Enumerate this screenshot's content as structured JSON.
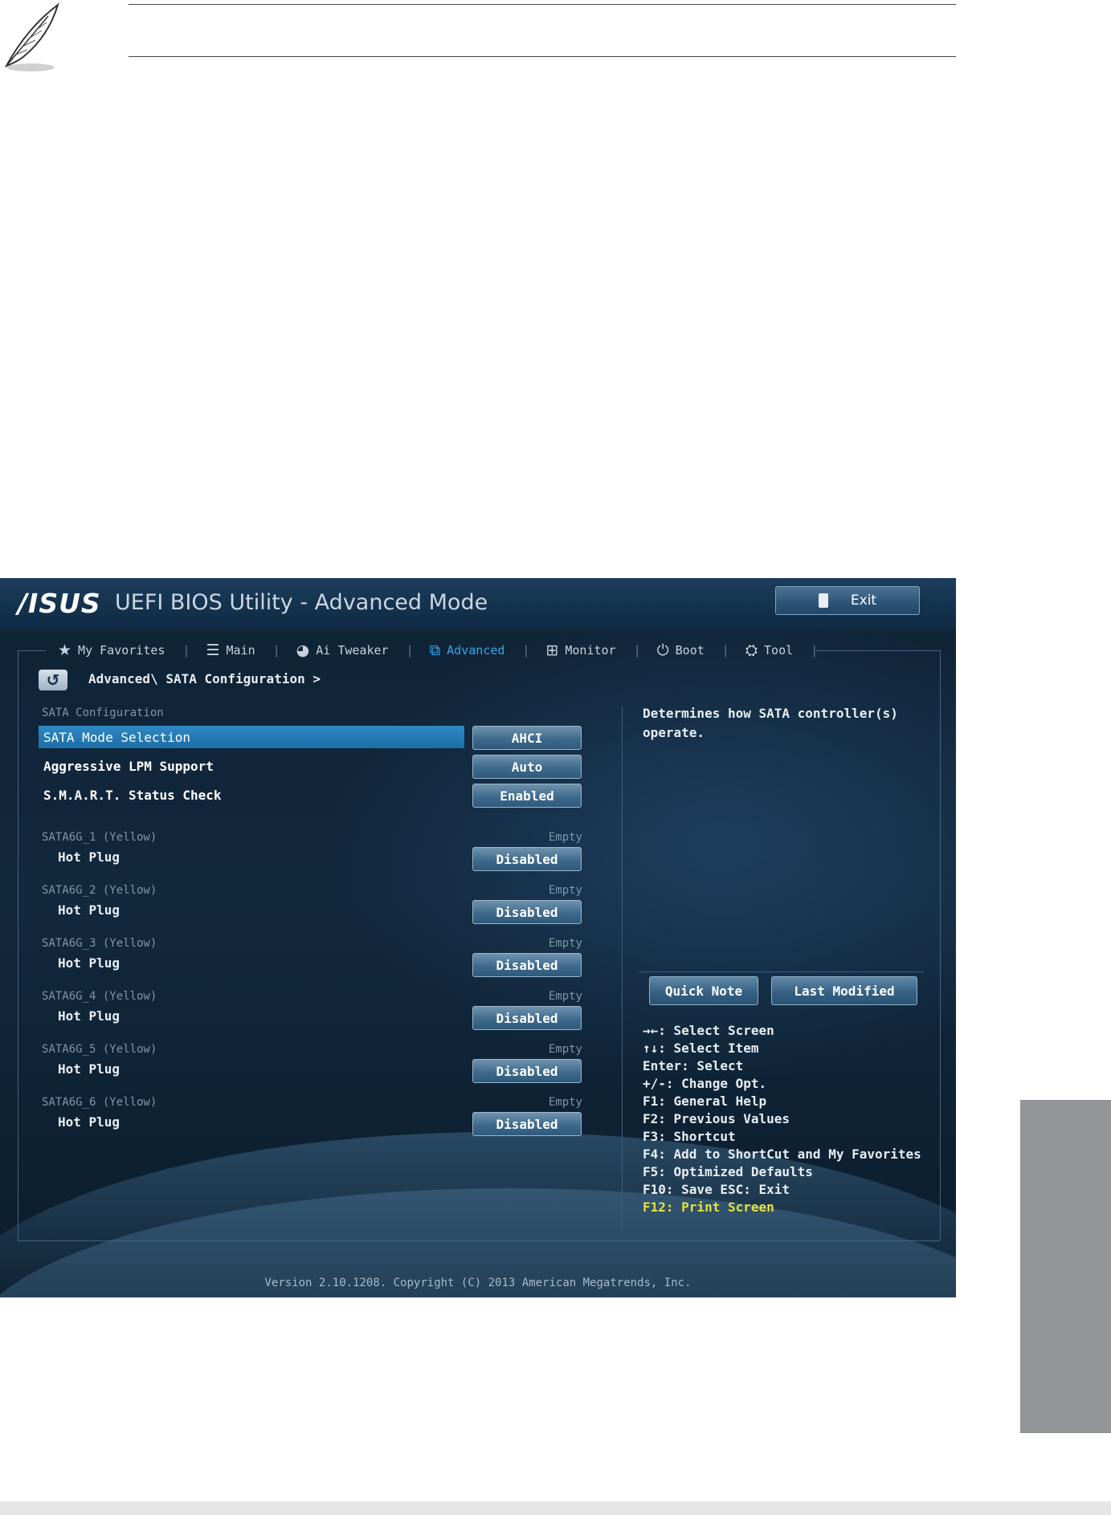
{
  "bios": {
    "logo": "/ISUS",
    "title": "UEFI BIOS Utility - Advanced Mode",
    "exit_label": "Exit",
    "tabs": [
      {
        "label": "My Favorites",
        "icon": "star-icon",
        "glyph": "★"
      },
      {
        "label": "Main",
        "icon": "list-icon",
        "glyph": "☰"
      },
      {
        "label": "Ai Tweaker",
        "icon": "tweaker-icon",
        "glyph": "◕"
      },
      {
        "label": "Advanced",
        "icon": "advanced-icon",
        "glyph": "⧉"
      },
      {
        "label": "Monitor",
        "icon": "monitor-icon",
        "glyph": "⊞"
      },
      {
        "label": "Boot",
        "icon": "power-icon",
        "glyph": "⏻"
      },
      {
        "label": "Tool",
        "icon": "tool-icon",
        "glyph": "⛭"
      }
    ],
    "active_tab": "Advanced",
    "back_glyph": "↺",
    "breadcrumb": "Advanced\\ SATA Configuration >",
    "section_title": "SATA Configuration",
    "settings": [
      {
        "label": "SATA Mode Selection",
        "value": "AHCI",
        "selected": true
      },
      {
        "label": "Aggressive LPM Support",
        "value": "Auto",
        "selected": false
      },
      {
        "label": "S.M.A.R.T. Status Check",
        "value": "Enabled",
        "selected": false
      }
    ],
    "ports": [
      {
        "label": "SATA6G_1 (Yellow)",
        "status": "Empty",
        "hotplug_label": "Hot Plug",
        "hotplug_value": "Disabled"
      },
      {
        "label": "SATA6G_2 (Yellow)",
        "status": "Empty",
        "hotplug_label": "Hot Plug",
        "hotplug_value": "Disabled"
      },
      {
        "label": "SATA6G_3 (Yellow)",
        "status": "Empty",
        "hotplug_label": "Hot Plug",
        "hotplug_value": "Disabled"
      },
      {
        "label": "SATA6G_4 (Yellow)",
        "status": "Empty",
        "hotplug_label": "Hot Plug",
        "hotplug_value": "Disabled"
      },
      {
        "label": "SATA6G_5 (Yellow)",
        "status": "Empty",
        "hotplug_label": "Hot Plug",
        "hotplug_value": "Disabled"
      },
      {
        "label": "SATA6G_6 (Yellow)",
        "status": "Empty",
        "hotplug_label": "Hot Plug",
        "hotplug_value": "Disabled"
      }
    ],
    "help_text": "Determines how SATA controller(s) operate.",
    "quick_note_label": "Quick Note",
    "last_modified_label": "Last Modified",
    "keys": [
      "→←: Select Screen",
      "↑↓: Select Item",
      "Enter: Select",
      "+/-: Change Opt.",
      "F1: General Help",
      "F2: Previous Values",
      "F3: Shortcut",
      "F4: Add to ShortCut and My Favorites",
      "F5: Optimized Defaults",
      "F10: Save  ESC: Exit",
      "F12: Print Screen"
    ],
    "version": "Version 2.10.1208. Copyright (C) 2013 American Megatrends, Inc."
  },
  "page": {
    "note_icon": "feather-pen-icon"
  }
}
